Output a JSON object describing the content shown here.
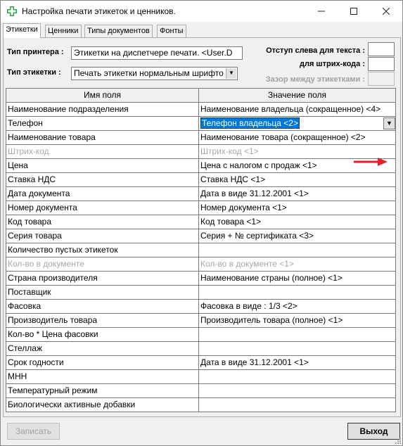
{
  "window": {
    "title": "Настройка печати этикеток и ценников.",
    "accent_color": "#0078d7"
  },
  "tabs": [
    {
      "label": "Этикетки",
      "active": true
    },
    {
      "label": "Ценники",
      "active": false
    },
    {
      "label": "Типы документов",
      "active": false
    },
    {
      "label": "Фонты",
      "active": false
    }
  ],
  "form": {
    "printer_type_label": "Тип принтера :",
    "printer_type_value": "Этикетки на диспетчере печати. <User.D",
    "label_type_label": "Тип этикетки :",
    "label_type_value": "Печать этикетки нормальным шрифто",
    "indent_left_label": "Отступ слева  для текста :",
    "barcode_label": "для штрих-кода :",
    "gap_label": "Зазор между этикетками :"
  },
  "grid": {
    "columns": [
      "Имя поля",
      "Значение поля"
    ],
    "rows": [
      {
        "name": "Наименование подразделения",
        "value": "Наименование владельца (сокращенное) <4>",
        "disabled": false
      },
      {
        "name": "Телефон",
        "value": "Телефон владельца <2>",
        "disabled": false,
        "selected": true
      },
      {
        "name": "Наименование товара",
        "value": "Наименование товара (сокращенное) <2>",
        "disabled": false
      },
      {
        "name": "Штрих-код",
        "value": "Штрих-код <1>",
        "disabled": true
      },
      {
        "name": "Цена",
        "value": "Цена с налогом с продаж <1>",
        "disabled": false
      },
      {
        "name": "Ставка НДС",
        "value": "Ставка НДС <1>",
        "disabled": false
      },
      {
        "name": "Дата документа",
        "value": "Дата в виде 31.12.2001 <1>",
        "disabled": false
      },
      {
        "name": "Номер документа",
        "value": "Номер документа <1>",
        "disabled": false
      },
      {
        "name": "Код товара",
        "value": "Код товара <1>",
        "disabled": false
      },
      {
        "name": "Серия товара",
        "value": "Серия + № сертификата <3>",
        "disabled": false
      },
      {
        "name": "Количество пустых этикеток",
        "value": "",
        "disabled": false
      },
      {
        "name": "Кол-во в документе",
        "value": "Кол-во в документе <1>",
        "disabled": true
      },
      {
        "name": "Страна производителя",
        "value": "Наименование страны (полное) <1>",
        "disabled": false
      },
      {
        "name": "Поставщик",
        "value": "",
        "disabled": false
      },
      {
        "name": "Фасовка",
        "value": "Фасовка в виде : 1/3    <2>",
        "disabled": false
      },
      {
        "name": "Производитель товара",
        "value": "Производитель товара (полное) <1>",
        "disabled": false
      },
      {
        "name": "Кол-во * Цена фасовки",
        "value": "",
        "disabled": false
      },
      {
        "name": "Стеллаж",
        "value": "",
        "disabled": false
      },
      {
        "name": "Срок годности",
        "value": "Дата в виде 31.12.2001 <1>",
        "disabled": false
      },
      {
        "name": "МНН",
        "value": "",
        "disabled": false
      },
      {
        "name": "Температурный режим",
        "value": "",
        "disabled": false
      },
      {
        "name": "Биологически активные добавки",
        "value": "",
        "disabled": false
      }
    ]
  },
  "buttons": {
    "save_label": "Записать",
    "exit_label": "Выход"
  },
  "annotation": {
    "arrow_color": "#e8202a"
  }
}
